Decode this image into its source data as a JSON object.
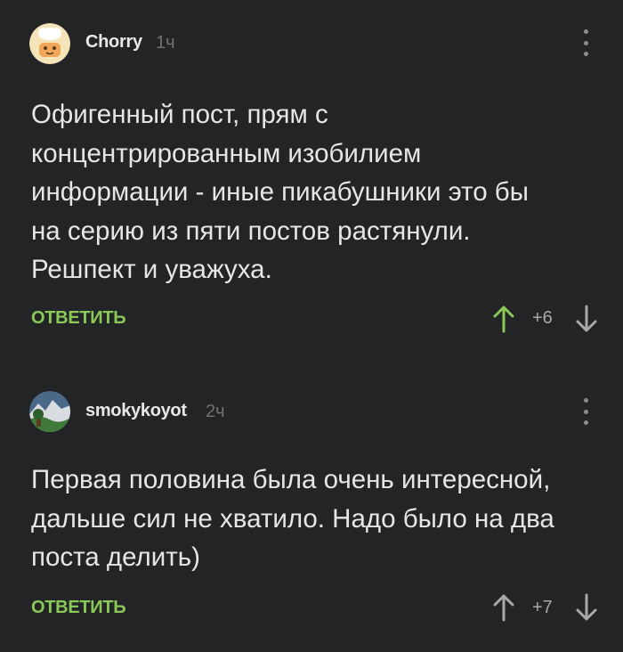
{
  "comments": [
    {
      "username": "Chorry",
      "time": "1ч",
      "text": "Офигенный пост, прям с\nконцентрированным изобилием\nинформации - иные пикабушники это бы\nна серию из пяти постов растянули.\nРешпект и уважуха.",
      "reply_label": "ОТВЕТИТЬ",
      "score": "+6",
      "upvote_color": "#8ac858"
    },
    {
      "username": "smokykoyot",
      "time": "2ч",
      "text": "Первая половина была очень интересной,\nдальше сил не хватило. Надо было на два\nпоста делить)",
      "reply_label": "ОТВЕТИТЬ",
      "score": "+7",
      "upvote_color": "#a7a9ab"
    }
  ],
  "icons": {
    "upvote": "arrow-up-icon",
    "downvote": "arrow-down-icon",
    "more": "more-vertical-icon"
  }
}
